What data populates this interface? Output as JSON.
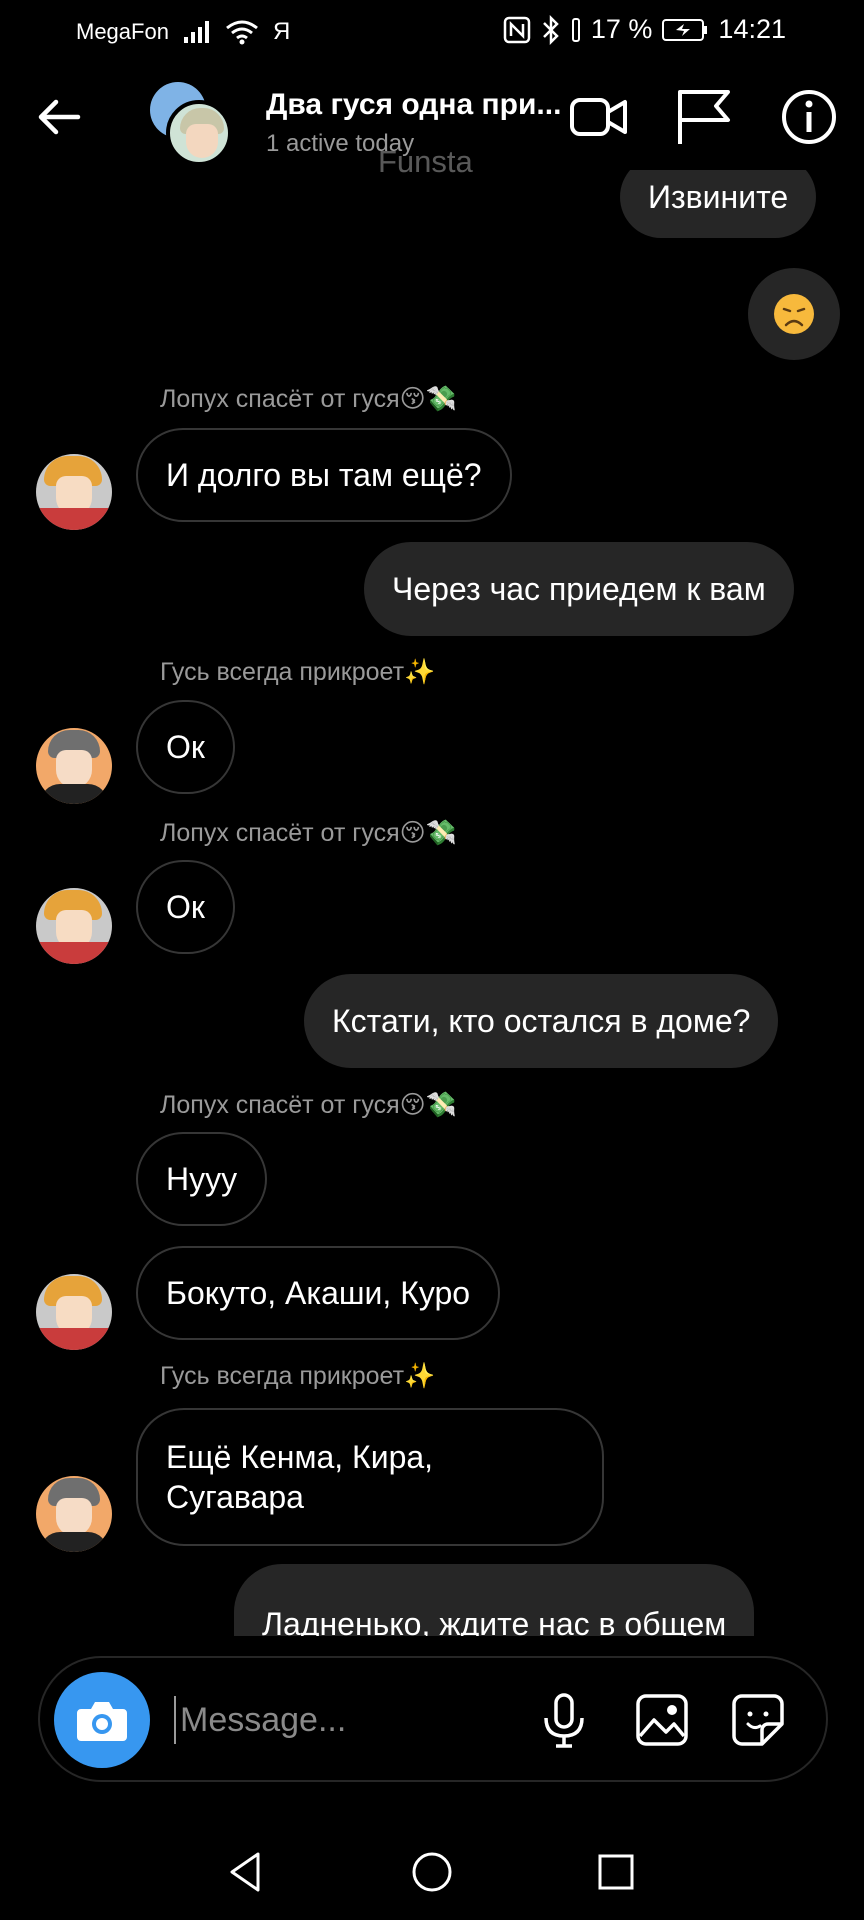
{
  "status_bar": {
    "carrier": "MegaFon",
    "ya": "Я",
    "battery": "17 %",
    "time": "14:21"
  },
  "header": {
    "title": "Два гуся одна при...",
    "subtitle": "1 active today",
    "watermark": "Funsta"
  },
  "messages": [
    {
      "type": "outgoing",
      "text": "Извините"
    },
    {
      "type": "outgoing-emoji",
      "emoji": "😞"
    },
    {
      "type": "sender",
      "text": "Лопух спасёт от гуся😚💸"
    },
    {
      "type": "incoming",
      "text": "И долго вы там ещё?",
      "avatar": "lopuh"
    },
    {
      "type": "outgoing",
      "text": "Через час приедем к вам"
    },
    {
      "type": "sender",
      "text": "Гусь всегда прикроет✨"
    },
    {
      "type": "incoming",
      "text": "Ок",
      "avatar": "gus"
    },
    {
      "type": "sender",
      "text": "Лопух спасёт от гуся😚💸"
    },
    {
      "type": "incoming",
      "text": "Ок",
      "avatar": "lopuh"
    },
    {
      "type": "outgoing",
      "text": "Кстати, кто остался в доме?"
    },
    {
      "type": "sender",
      "text": "Лопух спасёт от гуся😚💸"
    },
    {
      "type": "incoming",
      "text": "Нууу"
    },
    {
      "type": "incoming",
      "text": "Бокуто, Акаши, Куро",
      "avatar": "lopuh"
    },
    {
      "type": "sender",
      "text": "Гусь всегда прикроет✨"
    },
    {
      "type": "incoming",
      "text": "Ещё Кенма, Кира,\nСугавара",
      "avatar": "gus"
    },
    {
      "type": "outgoing",
      "text": "Ладненько, ждите нас в общем"
    }
  ],
  "composer": {
    "placeholder": "Message..."
  },
  "colors": {
    "background": "#000000",
    "bubble_out": "#262626",
    "bubble_in_border": "#363636",
    "camera_button": "#3797f0",
    "secondary_text": "#9a9a9a"
  }
}
